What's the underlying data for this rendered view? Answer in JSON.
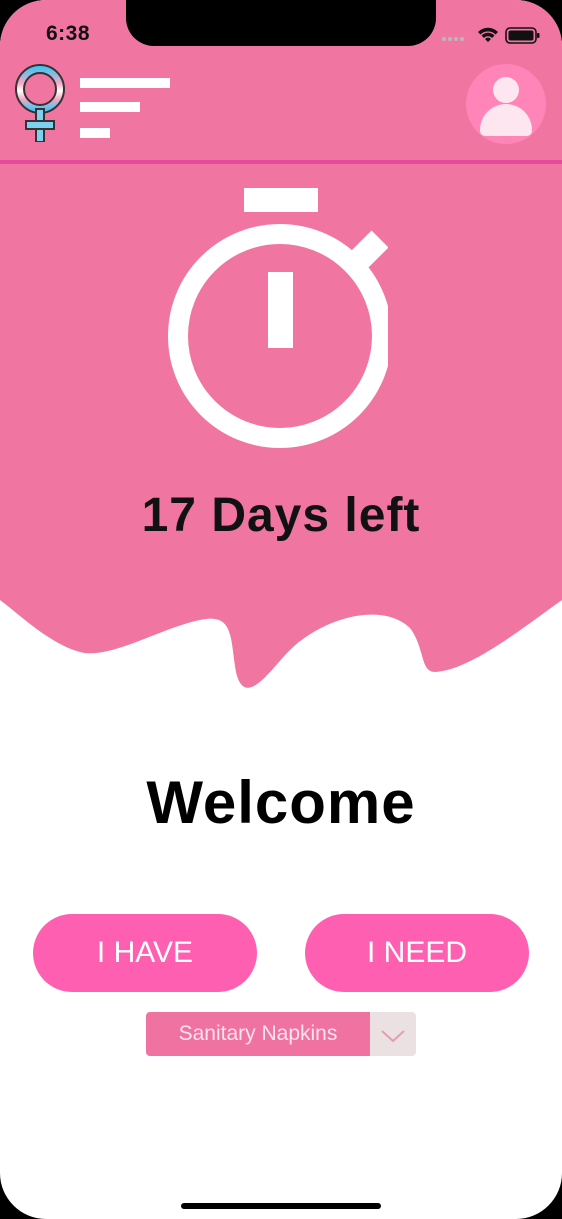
{
  "status_bar": {
    "time": "6:38"
  },
  "header": {
    "logo_icon": "female-symbol-icon",
    "menu_icon": "hamburger-menu-icon",
    "profile_icon": "user-avatar-icon"
  },
  "timer": {
    "icon": "stopwatch-icon",
    "countdown_text": "17 Days left"
  },
  "welcome": {
    "title": "Welcome"
  },
  "actions": {
    "have_label": "I HAVE",
    "need_label": "I NEED"
  },
  "product_select": {
    "selected": "Sanitary Napkins",
    "arrow_icon": "chevron-down-icon"
  },
  "colors": {
    "brand_pink": "#f075a0",
    "button_pink": "#ff5fb0",
    "divider_pink": "#e84a9a"
  }
}
